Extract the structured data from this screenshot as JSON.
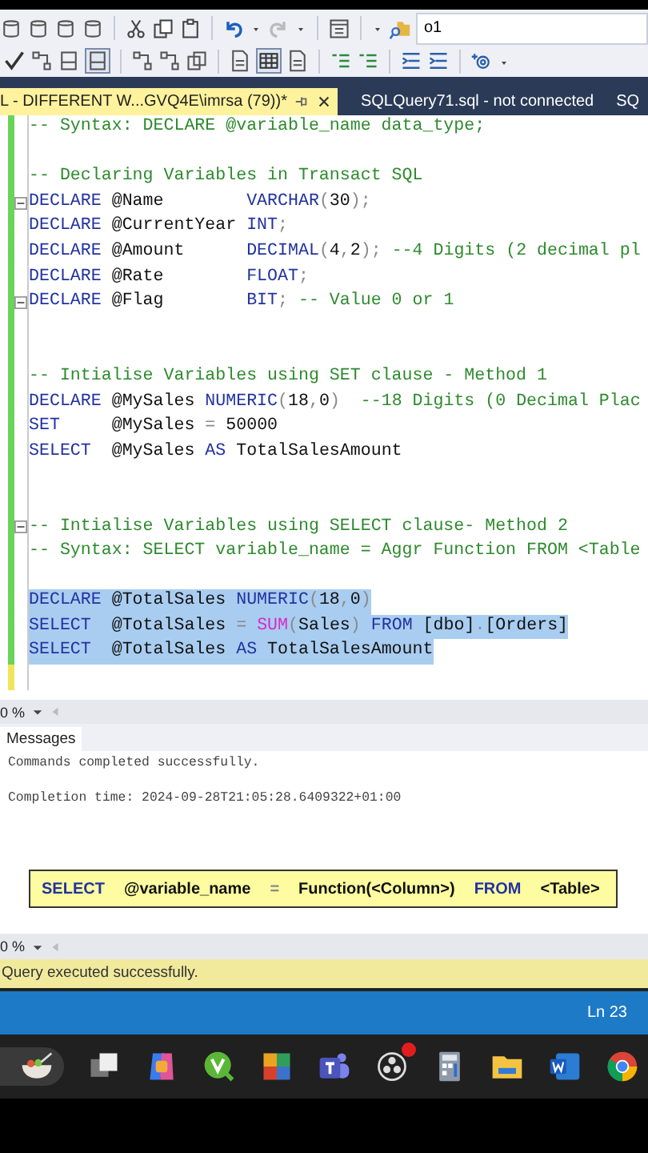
{
  "toolbar": {
    "search_value": "o1"
  },
  "tabs": [
    {
      "label": "L - DIFFERENT W...GVQ4E\\imrsa (79))*",
      "selected": true
    },
    {
      "label": "SQLQuery71.sql - not connected",
      "selected": false
    },
    {
      "label": "SQ",
      "selected": false
    }
  ],
  "editor": {
    "lines": [
      {
        "kind": "code",
        "fold": false,
        "selected": false,
        "edited": false,
        "tokens": [
          {
            "kind": "comment",
            "text": "-- Syntax: DECLARE @variable_name data_type;"
          }
        ]
      },
      {
        "kind": "blank",
        "edited": false
      },
      {
        "kind": "code",
        "fold": false,
        "selected": false,
        "edited": false,
        "tokens": [
          {
            "kind": "comment",
            "text": "-- Declaring Variables in Transact SQL"
          }
        ]
      },
      {
        "kind": "code",
        "fold": true,
        "selected": false,
        "edited": false,
        "tokens": [
          {
            "kind": "keyword",
            "text": "DECLARE"
          },
          {
            "kind": "plain",
            "text": " @Name        "
          },
          {
            "kind": "keyword",
            "text": "VARCHAR"
          },
          {
            "kind": "punct",
            "text": "("
          },
          {
            "kind": "plain",
            "text": "30"
          },
          {
            "kind": "punct",
            "text": ");"
          }
        ]
      },
      {
        "kind": "code",
        "fold": false,
        "selected": false,
        "edited": false,
        "tokens": [
          {
            "kind": "keyword",
            "text": "DECLARE"
          },
          {
            "kind": "plain",
            "text": " @CurrentYear "
          },
          {
            "kind": "keyword",
            "text": "INT"
          },
          {
            "kind": "punct",
            "text": ";"
          }
        ]
      },
      {
        "kind": "code",
        "fold": false,
        "selected": false,
        "edited": false,
        "tokens": [
          {
            "kind": "keyword",
            "text": "DECLARE"
          },
          {
            "kind": "plain",
            "text": " @Amount      "
          },
          {
            "kind": "keyword",
            "text": "DECIMAL"
          },
          {
            "kind": "punct",
            "text": "("
          },
          {
            "kind": "plain",
            "text": "4"
          },
          {
            "kind": "punct",
            "text": ","
          },
          {
            "kind": "plain",
            "text": "2"
          },
          {
            "kind": "punct",
            "text": ");"
          },
          {
            "kind": "comment",
            "text": " --4 Digits (2 decimal pl"
          }
        ]
      },
      {
        "kind": "code",
        "fold": false,
        "selected": false,
        "edited": false,
        "tokens": [
          {
            "kind": "keyword",
            "text": "DECLARE"
          },
          {
            "kind": "plain",
            "text": " @Rate        "
          },
          {
            "kind": "keyword",
            "text": "FLOAT"
          },
          {
            "kind": "punct",
            "text": ";"
          }
        ]
      },
      {
        "kind": "code",
        "fold": true,
        "selected": false,
        "edited": false,
        "tokens": [
          {
            "kind": "keyword",
            "text": "DECLARE"
          },
          {
            "kind": "plain",
            "text": " @Flag        "
          },
          {
            "kind": "keyword",
            "text": "BIT"
          },
          {
            "kind": "punct",
            "text": ";"
          },
          {
            "kind": "comment",
            "text": " -- Value 0 or 1"
          }
        ]
      },
      {
        "kind": "blank",
        "edited": false
      },
      {
        "kind": "blank",
        "edited": false
      },
      {
        "kind": "code",
        "fold": false,
        "selected": false,
        "edited": false,
        "tokens": [
          {
            "kind": "comment",
            "text": "-- Intialise Variables using SET clause - Method 1"
          }
        ]
      },
      {
        "kind": "code",
        "fold": false,
        "selected": false,
        "edited": false,
        "tokens": [
          {
            "kind": "keyword",
            "text": "DECLARE"
          },
          {
            "kind": "plain",
            "text": " @MySales "
          },
          {
            "kind": "keyword",
            "text": "NUMERIC"
          },
          {
            "kind": "punct",
            "text": "("
          },
          {
            "kind": "plain",
            "text": "18"
          },
          {
            "kind": "punct",
            "text": ","
          },
          {
            "kind": "plain",
            "text": "0"
          },
          {
            "kind": "punct",
            "text": ")"
          },
          {
            "kind": "comment",
            "text": "  --18 Digits (0 Decimal Plac"
          }
        ]
      },
      {
        "kind": "code",
        "fold": false,
        "selected": false,
        "edited": false,
        "tokens": [
          {
            "kind": "keyword",
            "text": "SET"
          },
          {
            "kind": "plain",
            "text": "     @MySales "
          },
          {
            "kind": "punct",
            "text": "="
          },
          {
            "kind": "plain",
            "text": " 50000"
          }
        ]
      },
      {
        "kind": "code",
        "fold": false,
        "selected": false,
        "edited": false,
        "tokens": [
          {
            "kind": "keyword",
            "text": "SELECT"
          },
          {
            "kind": "plain",
            "text": "  @MySales "
          },
          {
            "kind": "keyword",
            "text": "AS"
          },
          {
            "kind": "plain",
            "text": " TotalSalesAmount"
          }
        ]
      },
      {
        "kind": "blank",
        "edited": false
      },
      {
        "kind": "blank",
        "edited": false
      },
      {
        "kind": "code",
        "fold": true,
        "selected": false,
        "edited": false,
        "tokens": [
          {
            "kind": "comment",
            "text": "-- Intialise Variables using SELECT clause- Method 2"
          }
        ]
      },
      {
        "kind": "code",
        "fold": false,
        "selected": false,
        "edited": false,
        "tokens": [
          {
            "kind": "comment",
            "text": "-- Syntax: SELECT variable_name = Aggr Function FROM <Table"
          }
        ]
      },
      {
        "kind": "blank",
        "edited": false
      },
      {
        "kind": "code",
        "fold": false,
        "selected": true,
        "edited": false,
        "tokens": [
          {
            "kind": "keyword",
            "text": "DECLARE"
          },
          {
            "kind": "plain",
            "text": " @TotalSales "
          },
          {
            "kind": "keyword",
            "text": "NUMERIC"
          },
          {
            "kind": "punct",
            "text": "("
          },
          {
            "kind": "plain",
            "text": "18"
          },
          {
            "kind": "punct",
            "text": ","
          },
          {
            "kind": "plain",
            "text": "0"
          },
          {
            "kind": "punct",
            "text": ")"
          }
        ]
      },
      {
        "kind": "code",
        "fold": false,
        "selected": true,
        "edited": false,
        "tokens": [
          {
            "kind": "keyword",
            "text": "SELECT"
          },
          {
            "kind": "plain",
            "text": "  @TotalSales "
          },
          {
            "kind": "punct",
            "text": "= "
          },
          {
            "kind": "function",
            "text": "SUM"
          },
          {
            "kind": "punct",
            "text": "("
          },
          {
            "kind": "plain",
            "text": "Sales"
          },
          {
            "kind": "punct",
            "text": ") "
          },
          {
            "kind": "keyword",
            "text": "FROM"
          },
          {
            "kind": "plain",
            "text": " [dbo]"
          },
          {
            "kind": "punct",
            "text": "."
          },
          {
            "kind": "plain",
            "text": "[Orders]"
          }
        ]
      },
      {
        "kind": "code",
        "fold": false,
        "selected": true,
        "edited": false,
        "tokens": [
          {
            "kind": "keyword",
            "text": "SELECT"
          },
          {
            "kind": "plain",
            "text": "  @TotalSales "
          },
          {
            "kind": "keyword",
            "text": "AS"
          },
          {
            "kind": "plain",
            "text": " TotalSalesAmount"
          }
        ]
      },
      {
        "kind": "blank",
        "edited": true
      }
    ]
  },
  "editor_zoom": "0 %",
  "results": {
    "tab": "Messages",
    "messages": [
      "Commands completed successfully.",
      "Completion time: 2024-09-28T21:05:28.6409322+01:00"
    ]
  },
  "callout": {
    "tokens": [
      {
        "kind": "keyword",
        "text": "SELECT"
      },
      {
        "kind": "plain",
        "text": "@variable_name"
      },
      {
        "kind": "punct",
        "text": "="
      },
      {
        "kind": "plain",
        "text": "Function(<Column>)"
      },
      {
        "kind": "keyword",
        "text": "FROM"
      },
      {
        "kind": "plain",
        "text": "<Table>"
      }
    ]
  },
  "results_zoom": "0 %",
  "query_status": "Query executed successfully.",
  "status_bar": {
    "position": "Ln 23"
  }
}
